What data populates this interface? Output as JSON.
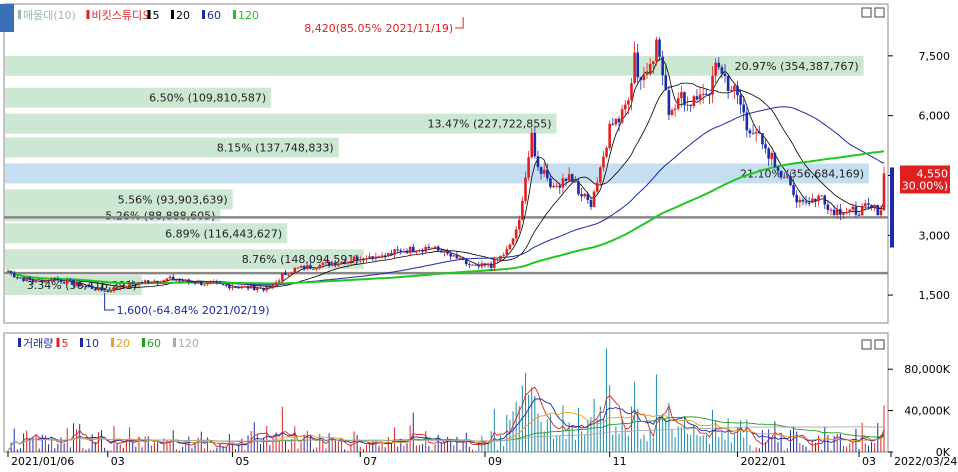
{
  "chart_data": [
    {
      "type": "candlestick",
      "price_panel": {
        "legend": [
          {
            "label": "매물대(10)",
            "color": "#9ab9b6"
          },
          {
            "label": "비킷스튜디오",
            "color": "#e02020"
          },
          {
            "label": "5",
            "color": "#000000"
          },
          {
            "label": "20",
            "color": "#000000"
          },
          {
            "label": "60",
            "color": "#1c2aa8"
          },
          {
            "label": "120",
            "color": "#1fc81f"
          }
        ],
        "y_ticks": [
          {
            "value": 1500,
            "label": "1,500"
          },
          {
            "value": 3000,
            "label": "3,000"
          },
          {
            "value": 4500,
            "label": "4,500"
          },
          {
            "value": 6000,
            "label": "6,000"
          },
          {
            "value": 7500,
            "label": "7,500"
          }
        ],
        "ylim": [
          800,
          8800
        ],
        "volume_profile": [
          {
            "price_lo": 7000,
            "price_hi": 7500,
            "label": "20.97% (354,387,767)"
          },
          {
            "price_lo": 6200,
            "price_hi": 6700,
            "label": "6.50% (109,810,587)"
          },
          {
            "price_lo": 5550,
            "price_hi": 6050,
            "label": "13.47% (227,722,855)"
          },
          {
            "price_lo": 4950,
            "price_hi": 5450,
            "label": "8.15% (137,748,833)"
          },
          {
            "price_lo": 4300,
            "price_hi": 4800,
            "label": "21.10% (356,684,169)",
            "highlight": true
          },
          {
            "price_lo": 3650,
            "price_hi": 4150,
            "label": "5.56% (93,903,639)"
          },
          {
            "price_lo": 3350,
            "price_hi": 3650,
            "label": "5.26% (88,888,605)"
          },
          {
            "price_lo": 2800,
            "price_hi": 3300,
            "label": "6.89% (116,443,627)"
          },
          {
            "price_lo": 2150,
            "price_hi": 2650,
            "label": "8.76% (148,094,591)"
          },
          {
            "price_lo": 1500,
            "price_hi": 2000,
            "label": "3.34% (56,416,291)"
          }
        ],
        "h_lines": [
          3450,
          2050
        ],
        "annotations": [
          {
            "text": "8,420(85.05% 2021/11/19)",
            "price": 8420,
            "date_idx": 146
          },
          {
            "text": "1,600(-64.84% 2021/02/19)",
            "price": 1600,
            "date_idx": 31
          }
        ],
        "current_price": {
          "label": "4,550",
          "change": "( 30.00%)"
        }
      },
      "volume_panel": {
        "legend": [
          {
            "label": "거래량",
            "color": "#1c2aa8"
          },
          {
            "label": "5",
            "color": "#e02020"
          },
          {
            "label": "10",
            "color": "#1c2aa8"
          },
          {
            "label": "20",
            "color": "#e8a020"
          },
          {
            "label": "60",
            "color": "#1fa01f"
          },
          {
            "label": "120",
            "color": "#aaaaaa"
          }
        ],
        "y_ticks": [
          {
            "value": 0,
            "label": "0K"
          },
          {
            "value": 40000,
            "label": "40,000K"
          },
          {
            "value": 80000,
            "label": "80,000K"
          }
        ],
        "ylim": [
          0,
          115000
        ]
      },
      "x_ticks": [
        {
          "label": "2021/01/06",
          "date_idx": 0
        },
        {
          "label": "03",
          "date_idx": 32
        },
        {
          "label": "05",
          "date_idx": 72
        },
        {
          "label": "07",
          "date_idx": 113
        },
        {
          "label": "09",
          "date_idx": 153
        },
        {
          "label": "11",
          "date_idx": 193
        },
        {
          "label": "2022/01",
          "date_idx": 234
        },
        {
          "label": "03",
          "date_idx": 273
        },
        {
          "label": "2022/03/24",
          "date_idx": 288
        }
      ],
      "n_days": 282,
      "anchors": [
        [
          0,
          2100
        ],
        [
          3,
          1950
        ],
        [
          8,
          1850
        ],
        [
          15,
          1900
        ],
        [
          22,
          1780
        ],
        [
          31,
          1600
        ],
        [
          38,
          1750
        ],
        [
          45,
          1850
        ],
        [
          52,
          1900
        ],
        [
          60,
          1820
        ],
        [
          68,
          1750
        ],
        [
          75,
          1700
        ],
        [
          80,
          1680
        ],
        [
          84,
          1650
        ],
        [
          88,
          2000
        ],
        [
          92,
          2150
        ],
        [
          100,
          2250
        ],
        [
          108,
          2350
        ],
        [
          115,
          2500
        ],
        [
          120,
          2450
        ],
        [
          125,
          2600
        ],
        [
          130,
          2650
        ],
        [
          135,
          2700
        ],
        [
          140,
          2550
        ],
        [
          145,
          2350
        ],
        [
          150,
          2200
        ],
        [
          155,
          2250
        ],
        [
          160,
          2600
        ],
        [
          163,
          3100
        ],
        [
          166,
          4300
        ],
        [
          168,
          5500
        ],
        [
          170,
          4700
        ],
        [
          172,
          4500
        ],
        [
          176,
          4200
        ],
        [
          180,
          4500
        ],
        [
          184,
          4000
        ],
        [
          187,
          3800
        ],
        [
          190,
          4700
        ],
        [
          193,
          5700
        ],
        [
          196,
          6000
        ],
        [
          199,
          6600
        ],
        [
          201,
          7400
        ],
        [
          203,
          7000
        ],
        [
          206,
          7300
        ],
        [
          208,
          7700
        ],
        [
          210,
          6800
        ],
        [
          212,
          6200
        ],
        [
          215,
          6400
        ],
        [
          220,
          6300
        ],
        [
          224,
          6500
        ],
        [
          228,
          7300
        ],
        [
          231,
          6800
        ],
        [
          234,
          6500
        ],
        [
          237,
          5800
        ],
        [
          240,
          5500
        ],
        [
          243,
          5200
        ],
        [
          246,
          4800
        ],
        [
          249,
          4500
        ],
        [
          252,
          4000
        ],
        [
          255,
          3850
        ],
        [
          258,
          3900
        ],
        [
          261,
          4000
        ],
        [
          264,
          3650
        ],
        [
          268,
          3600
        ],
        [
          272,
          3600
        ],
        [
          276,
          3700
        ],
        [
          280,
          3600
        ],
        [
          281,
          4550
        ]
      ]
    }
  ]
}
